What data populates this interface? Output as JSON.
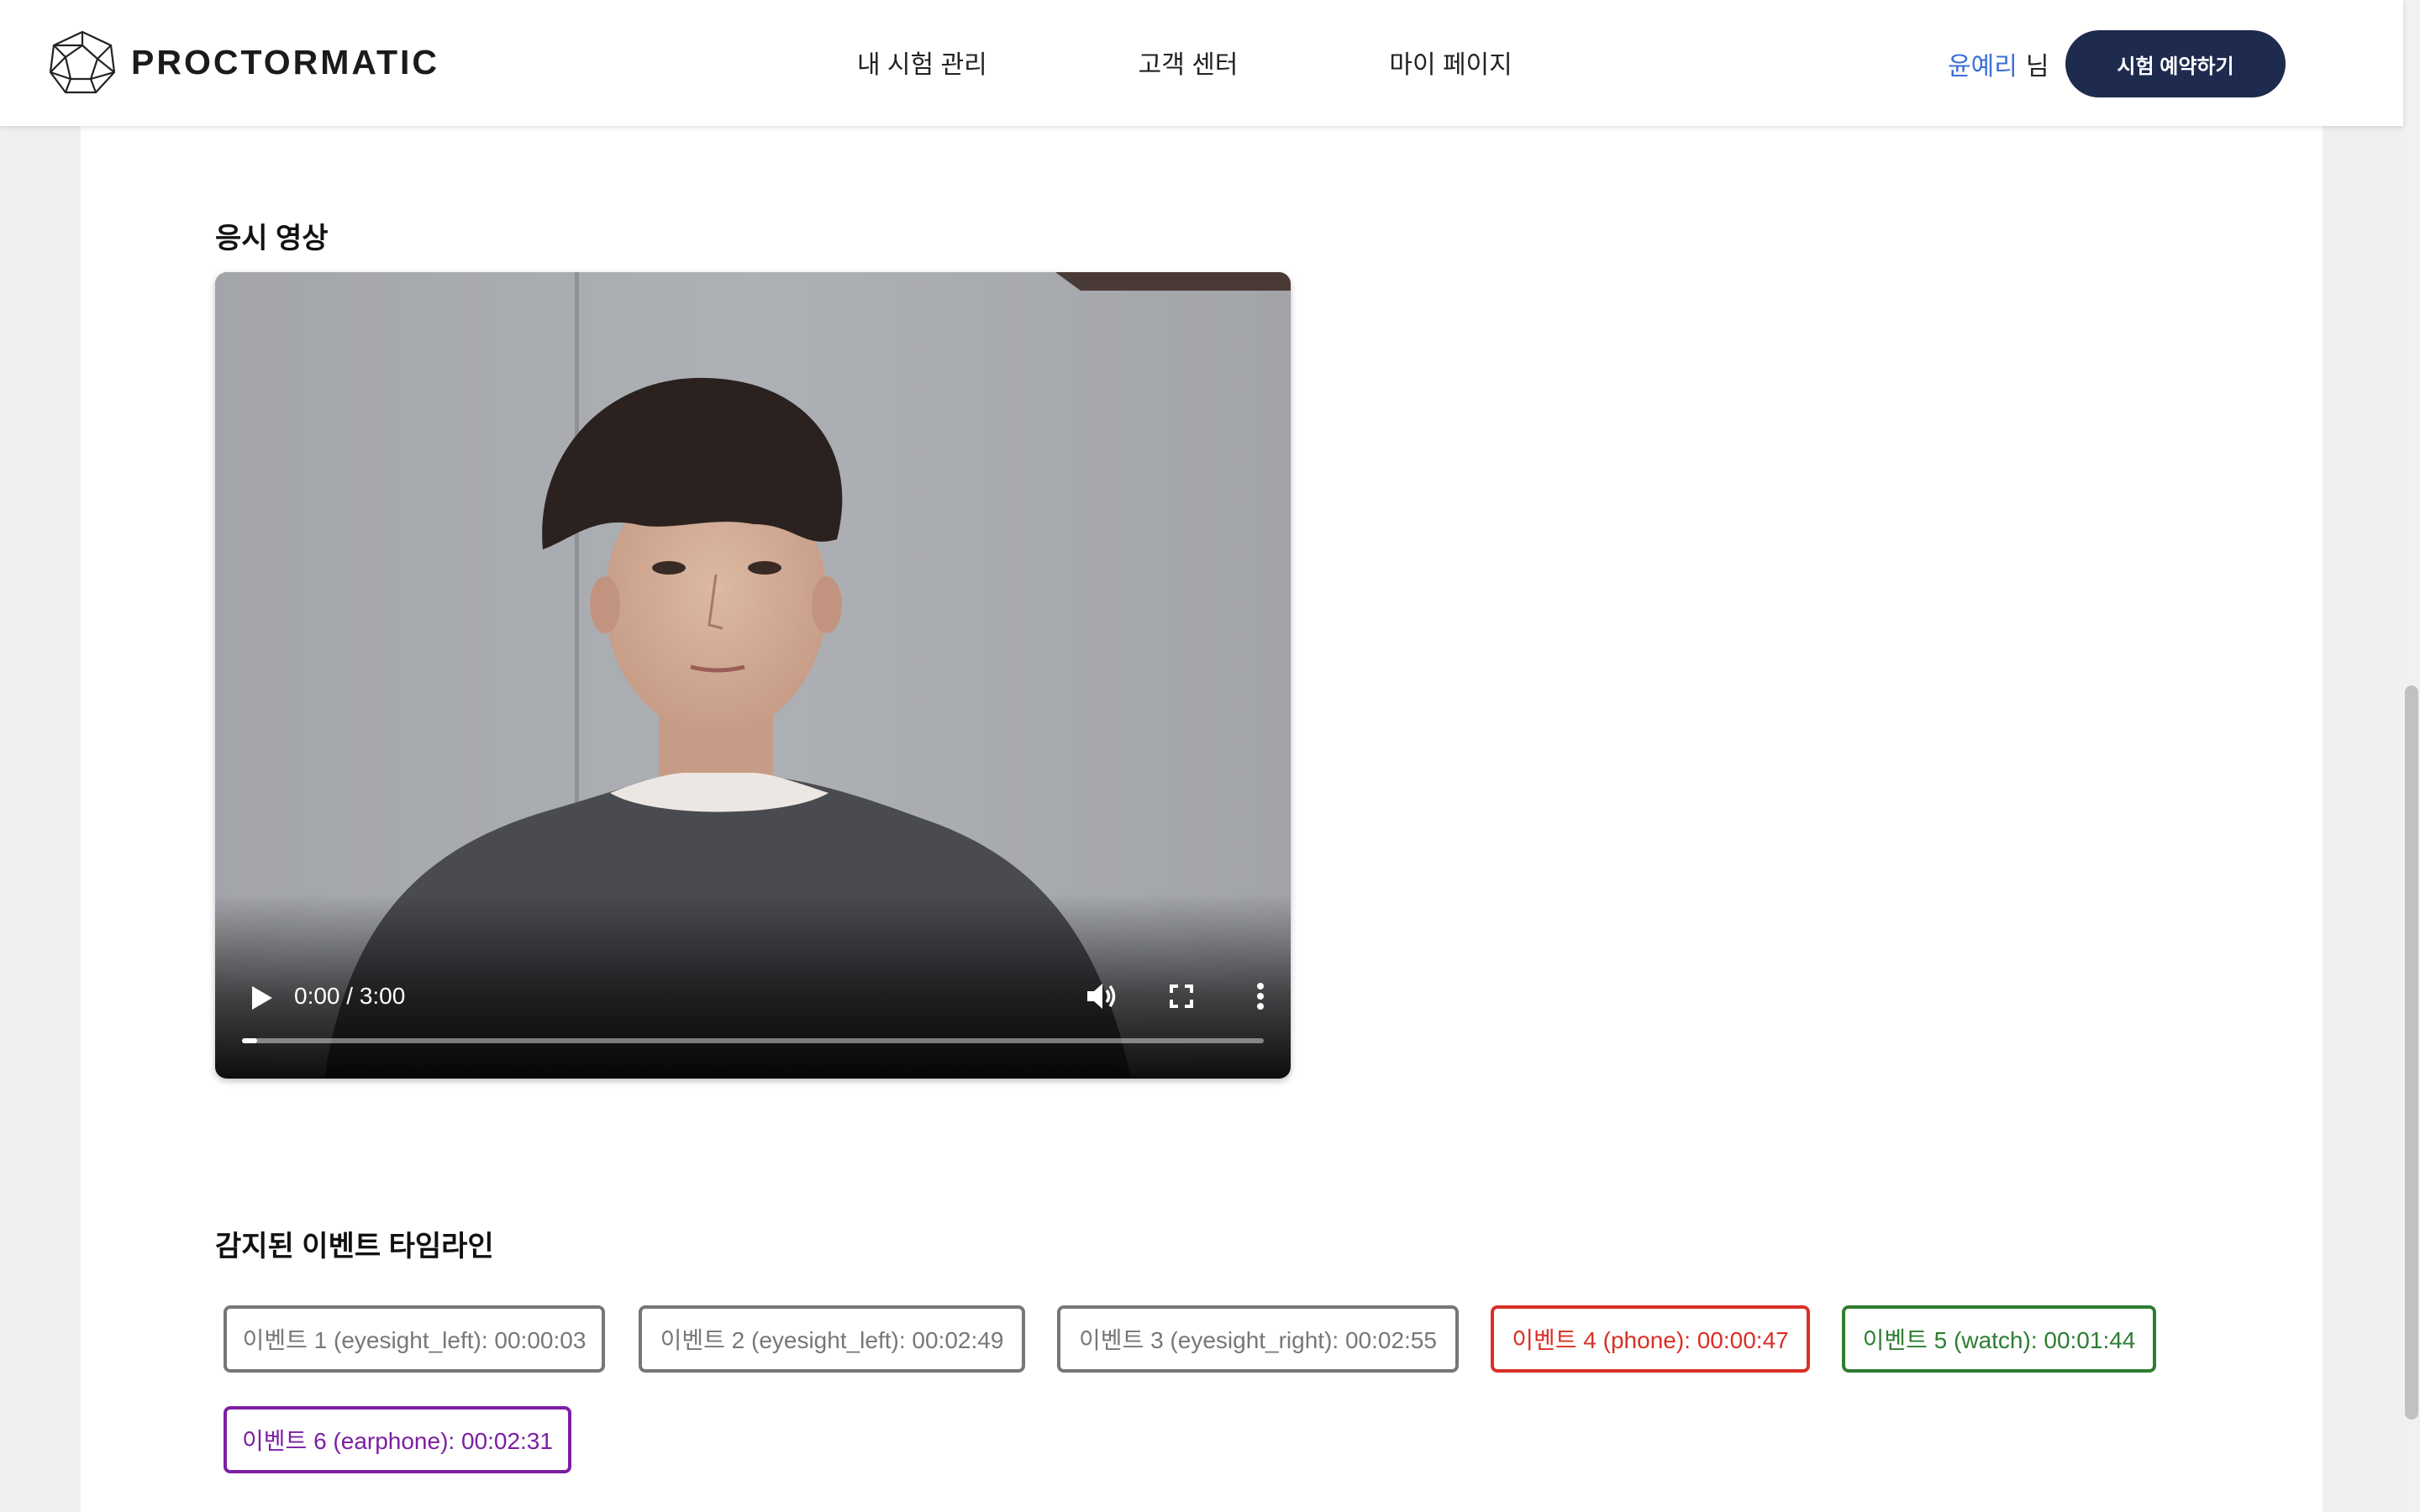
{
  "header": {
    "logo_text": "PROCTORMATIC",
    "nav": [
      "내 시험 관리",
      "고객 센터",
      "마이 페이지"
    ],
    "user_name": "윤예리",
    "user_suffix": "님",
    "reserve_button": "시험 예약하기"
  },
  "video_section": {
    "title": "응시 영상",
    "time_display": "0:00 / 3:00",
    "progress": 0.015
  },
  "events_section": {
    "title": "감지된 이벤트 타임라인",
    "events": [
      {
        "label": "이벤트 1 (eyesight_left): 00:00:03",
        "color": "#777777"
      },
      {
        "label": "이벤트 2 (eyesight_left): 00:02:49",
        "color": "#777777"
      },
      {
        "label": "이벤트 3 (eyesight_right): 00:02:55",
        "color": "#777777"
      },
      {
        "label": "이벤트 4 (phone): 00:00:47",
        "color": "#d93025"
      },
      {
        "label": "이벤트 5 (watch): 00:01:44",
        "color": "#2e7d32"
      },
      {
        "label": "이벤트 6 (earphone): 00:02:31",
        "color": "#7b1fa2"
      }
    ]
  },
  "colors": {
    "brand_navy": "#1e2a4e",
    "user_blue": "#3c6fd8"
  },
  "icons": {
    "logo": "polyhedron-logo-icon",
    "play": "play-icon",
    "volume": "volume-icon",
    "fullscreen": "fullscreen-icon",
    "more": "more-vert-icon"
  }
}
